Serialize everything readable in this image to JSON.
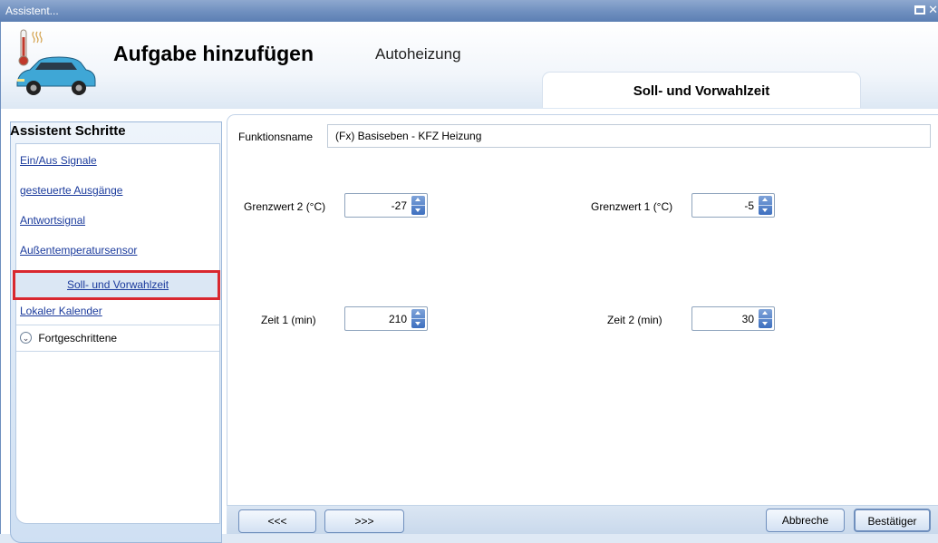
{
  "window": {
    "title": "Assistent..."
  },
  "header": {
    "title": "Aufgabe hinzufügen",
    "subtitle": "Autoheizung",
    "step_tab": "Soll- und Vorwahlzeit"
  },
  "sidebar": {
    "heading": "Assistent Schritte",
    "items": [
      {
        "label": "Ein/Aus Signale"
      },
      {
        "label": "gesteuerte Ausgänge"
      },
      {
        "label": "Antwortsignal"
      },
      {
        "label": "Außentemperatursensor"
      },
      {
        "label": "Soll- und Vorwahlzeit",
        "selected": true
      },
      {
        "label": "Lokaler Kalender"
      }
    ],
    "advanced": "Fortgeschrittene"
  },
  "form": {
    "function_name_label": "Funktionsname",
    "function_name_value": "(Fx) Basiseben - KFZ Heizung",
    "fields": {
      "grenzwert2": {
        "label": "Grenzwert 2 (°C)",
        "value": "-27"
      },
      "grenzwert1": {
        "label": "Grenzwert 1 (°C)",
        "value": "-5"
      },
      "zeit1": {
        "label": "Zeit 1 (min)",
        "value": "210"
      },
      "zeit2": {
        "label": "Zeit 2 (min)",
        "value": "30"
      }
    }
  },
  "footer": {
    "prev": "<<<",
    "next": ">>>",
    "cancel": "Abbreche",
    "confirm": "Bestätiger"
  },
  "colors": {
    "titlebar": "#6f8fbf",
    "selected_outline": "#d9282f",
    "link": "#1a3a9c",
    "car": "#3fa7d6"
  }
}
